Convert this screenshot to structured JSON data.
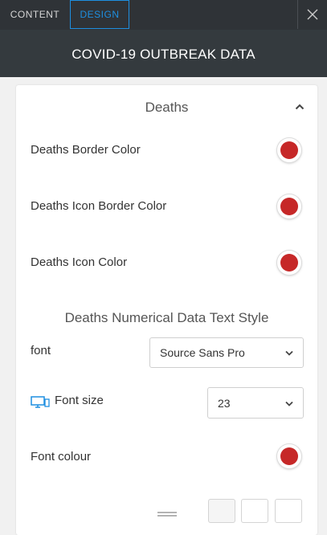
{
  "tabs": [
    {
      "label": "CONTENT",
      "active": false
    },
    {
      "label": "DESIGN",
      "active": true
    }
  ],
  "icons": {
    "close": "close-icon",
    "collapse": "chevron-up-icon",
    "dropdown": "chevron-down-icon",
    "device": "desktop-icon",
    "drag": "drag-handle-icon"
  },
  "header": {
    "title": "COVID-19 OUTBREAK DATA"
  },
  "section": {
    "title": "Deaths",
    "color_rows": [
      {
        "label": "Deaths Border Color",
        "color": "#c62828"
      },
      {
        "label": "Deaths Icon Border Color",
        "color": "#c62828"
      },
      {
        "label": "Deaths Icon Color",
        "color": "#c62828"
      }
    ],
    "text_style": {
      "heading": "Deaths Numerical Data Text Style",
      "font_label": "font",
      "font_value": "Source Sans Pro",
      "font_size_label": "Font size",
      "font_size_value": "23",
      "font_colour_label": "Font colour",
      "font_colour": "#c62828"
    }
  },
  "colors": {
    "accent": "#1e8fe0",
    "dark_bar": "#343a3e",
    "swatch_red": "#c62828"
  }
}
